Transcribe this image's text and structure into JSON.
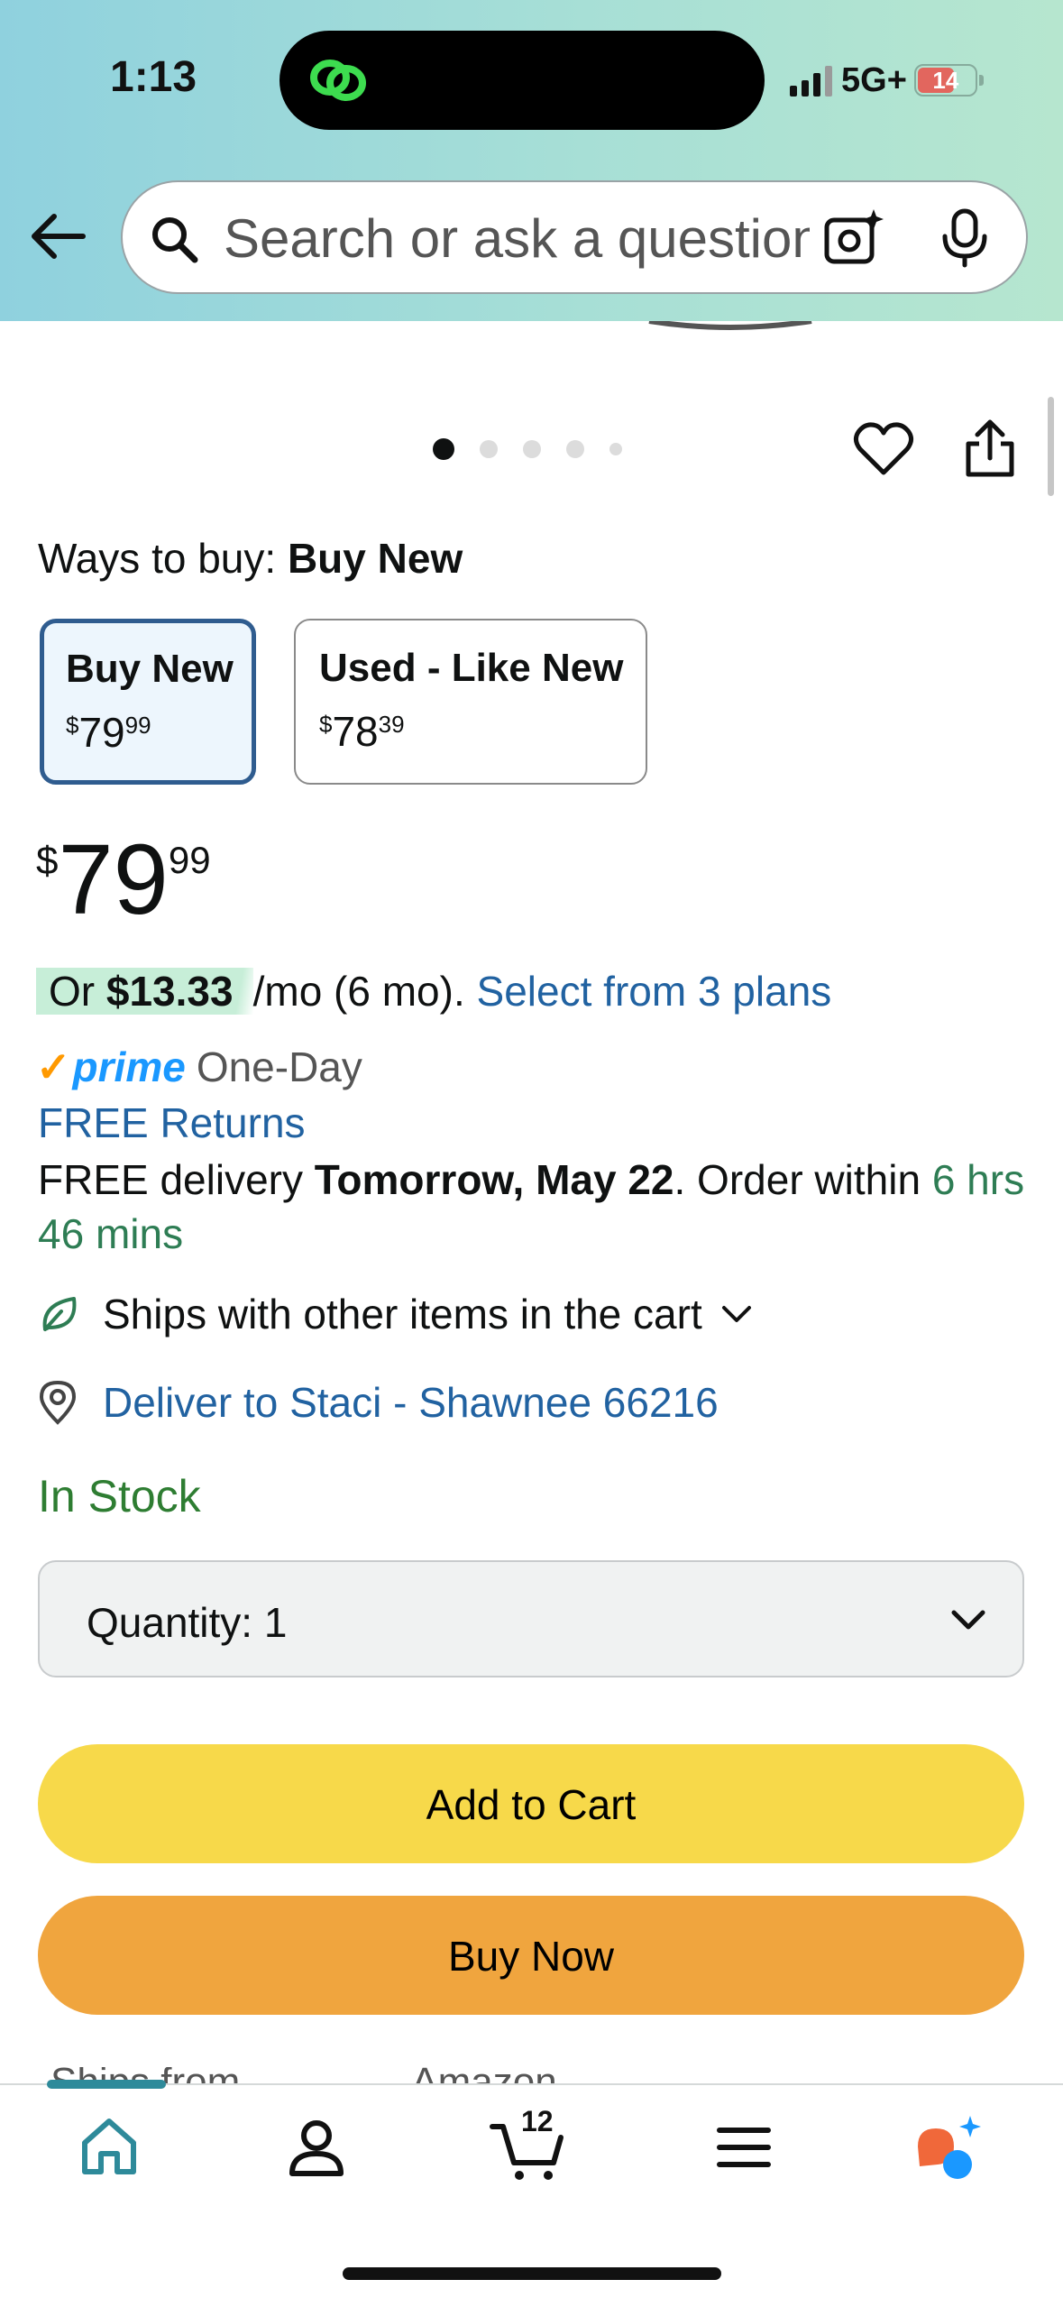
{
  "status_bar": {
    "time": "1:13",
    "network": "5G+",
    "battery": "14"
  },
  "search": {
    "placeholder": "Search or ask a question"
  },
  "ways_to_buy": {
    "label": "Ways to buy:",
    "selected": "Buy New"
  },
  "options": [
    {
      "title": "Buy New",
      "price_symbol": "$",
      "price_whole": "79",
      "price_fraction": "99"
    },
    {
      "title": "Used - Like New",
      "price_symbol": "$",
      "price_whole": "78",
      "price_fraction": "39"
    }
  ],
  "price": {
    "symbol": "$",
    "whole": "79",
    "fraction": "99"
  },
  "installment": {
    "prefix": "Or",
    "amount": "$13.33",
    "term": "/mo (6 mo).",
    "link": "Select from 3 plans"
  },
  "prime": {
    "logo": "prime",
    "label": "One-Day"
  },
  "free_returns": "FREE Returns",
  "delivery": {
    "prefix": "FREE delivery",
    "date": "Tomorrow, May 22",
    "middle": ". Order within",
    "countdown": "6 hrs 46 mins"
  },
  "ships_with": "Ships with other items in the cart",
  "deliver_to": "Deliver to Staci - Shawnee 66216",
  "stock": "In Stock",
  "quantity": {
    "label": "Quantity:",
    "value": "1"
  },
  "buttons": {
    "add_to_cart": "Add to Cart",
    "buy_now": "Buy Now"
  },
  "peek": {
    "left": "Ships from",
    "right": "Amazon"
  },
  "tabbar": {
    "cart_count": "12"
  },
  "colors": {
    "buy_box_selected": "#2f5c8f",
    "add_to_cart": "#f7d94a",
    "buy_now": "#f0a53e",
    "link": "#2162a1",
    "in_stock": "#2e7d32"
  }
}
